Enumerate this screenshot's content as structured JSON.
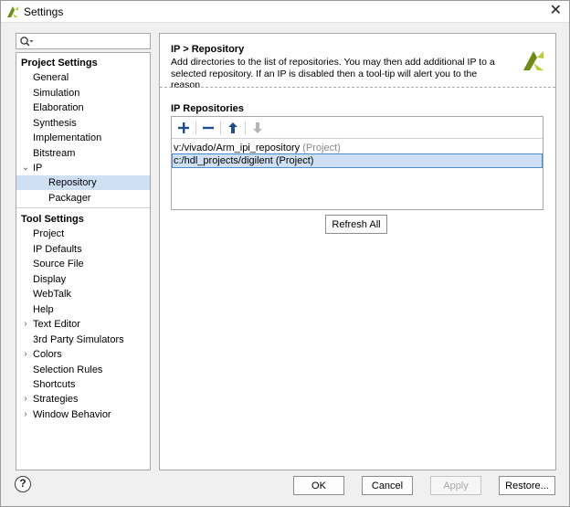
{
  "window": {
    "title": "Settings",
    "close_glyph": "✕"
  },
  "search": {
    "placeholder": ""
  },
  "tree": {
    "project_settings_label": "Project Settings",
    "project_items": [
      "General",
      "Simulation",
      "Elaboration",
      "Synthesis",
      "Implementation",
      "Bitstream"
    ],
    "ip_label": "IP",
    "ip_children": [
      "Repository",
      "Packager"
    ],
    "selected": "Repository",
    "tool_settings_label": "Tool Settings",
    "tool_items": [
      "Project",
      "IP Defaults",
      "Source File",
      "Display",
      "WebTalk",
      "Help",
      "Text Editor",
      "3rd Party Simulators",
      "Colors",
      "Selection Rules",
      "Shortcuts",
      "Strategies",
      "Window Behavior"
    ],
    "expandable_tool_items": [
      "Text Editor",
      "Colors",
      "Strategies",
      "Window Behavior"
    ]
  },
  "header": {
    "title": "IP > Repository",
    "description": "Add directories to the list of repositories. You may then add additional IP to a selected repository. If an IP is disabled then a tool-tip will alert you to the reason."
  },
  "repositories": {
    "section_title": "IP Repositories",
    "items": [
      {
        "path": "v:/vivado/Arm_ipi_repository",
        "note": "(Project)",
        "selected": false
      },
      {
        "path": "c:/hdl_projects/digilent (Project)",
        "note": "",
        "selected": true
      }
    ],
    "toolbar": {
      "add_glyph": "+",
      "remove_glyph": "−",
      "move_up_glyph": "🡅",
      "move_down_glyph": "🡇"
    },
    "refresh_label": "Refresh All"
  },
  "footer": {
    "help_label": "?",
    "ok_label": "OK",
    "cancel_label": "Cancel",
    "apply_label": "Apply",
    "apply_disabled": true,
    "restore_label": "Restore..."
  },
  "colors": {
    "selection": "#cfe0f4",
    "selection_border": "#4a8bd6",
    "brand_dark": "#6e8b1a",
    "brand_light": "#b6cf30",
    "toolbar_icon": "#1f4e8c"
  },
  "icons": [
    "vivado-logo-icon",
    "search-icon",
    "add-icon",
    "remove-icon",
    "move-up-icon",
    "move-down-icon",
    "chevron-down-icon",
    "chevron-right-icon",
    "help-icon",
    "close-icon"
  ]
}
